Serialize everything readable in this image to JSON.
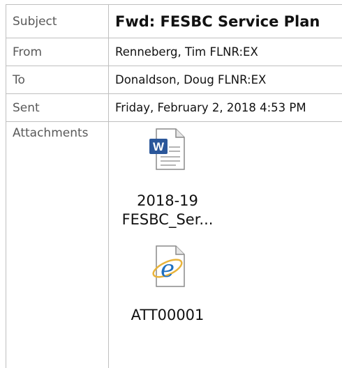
{
  "header": {
    "subject_label": "Subject",
    "subject": "Fwd: FESBC Service Plan",
    "from_label": "From",
    "from": "Renneberg, Tim FLNR:EX",
    "to_label": "To",
    "to": "Donaldson, Doug FLNR:EX",
    "sent_label": "Sent",
    "sent": "Friday, February 2, 2018 4:53 PM",
    "attachments_label": "Attachments"
  },
  "attachments": [
    {
      "name": "2018-19\nFESBC_Ser...",
      "icon": "word-document-icon"
    },
    {
      "name": "ATT00001",
      "icon": "internet-explorer-file-icon"
    }
  ],
  "colors": {
    "border": "#bfbfbf",
    "label_text": "#595959",
    "word_blue": "#2b579a",
    "ie_blue": "#1e6fc0"
  }
}
